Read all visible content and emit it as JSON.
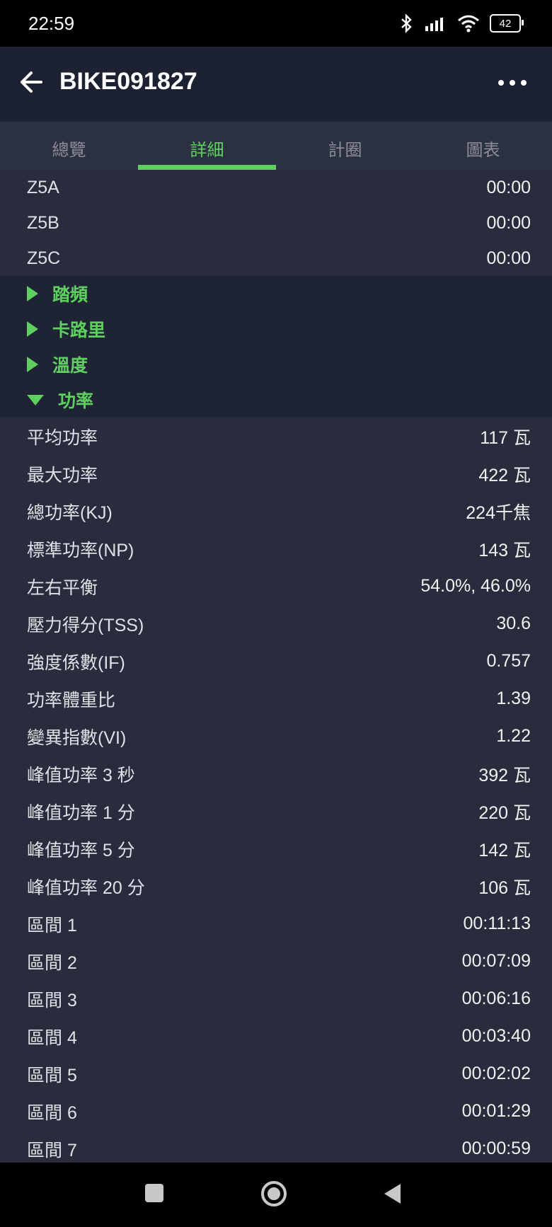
{
  "status": {
    "time": "22:59",
    "battery": "42",
    "signal_sub": "6"
  },
  "appbar": {
    "title": "BIKE091827"
  },
  "tabs": [
    {
      "label": "總覽",
      "active": false
    },
    {
      "label": "詳細",
      "active": true
    },
    {
      "label": "計圈",
      "active": false
    },
    {
      "label": "圖表",
      "active": false
    }
  ],
  "zones": [
    {
      "label": "Z5A",
      "value": "00:00"
    },
    {
      "label": "Z5B",
      "value": "00:00"
    },
    {
      "label": "Z5C",
      "value": "00:00"
    }
  ],
  "sections": [
    {
      "label": "踏頻",
      "expanded": false
    },
    {
      "label": "卡路里",
      "expanded": false
    },
    {
      "label": "溫度",
      "expanded": false
    },
    {
      "label": "功率",
      "expanded": true
    }
  ],
  "power": [
    {
      "label": "平均功率",
      "value": "117 瓦"
    },
    {
      "label": "最大功率",
      "value": "422 瓦"
    },
    {
      "label": "總功率(KJ)",
      "value": "224千焦"
    },
    {
      "label": "標準功率(NP)",
      "value": "143 瓦"
    },
    {
      "label": "左右平衡",
      "value": "54.0%, 46.0%"
    },
    {
      "label": "壓力得分(TSS)",
      "value": "30.6"
    },
    {
      "label": "強度係數(IF)",
      "value": "0.757"
    },
    {
      "label": "功率體重比",
      "value": "1.39"
    },
    {
      "label": "變異指數(VI)",
      "value": "1.22"
    },
    {
      "label": "峰值功率 3 秒",
      "value": "392 瓦"
    },
    {
      "label": "峰值功率 1 分",
      "value": "220 瓦"
    },
    {
      "label": "峰值功率 5 分",
      "value": "142 瓦"
    },
    {
      "label": "峰值功率 20 分",
      "value": "106 瓦"
    },
    {
      "label": "區間 1",
      "value": "00:11:13"
    },
    {
      "label": "區間 2",
      "value": "00:07:09"
    },
    {
      "label": "區間 3",
      "value": "00:06:16"
    },
    {
      "label": "區間 4",
      "value": "00:03:40"
    },
    {
      "label": "區間 5",
      "value": "00:02:02"
    },
    {
      "label": "區間 6",
      "value": "00:01:29"
    },
    {
      "label": "區間 7",
      "value": "00:00:59"
    }
  ],
  "colors": {
    "accent": "#5ed060",
    "background": "#282c3c",
    "section_bg": "#1f2434",
    "appbar_bg": "#1d2232"
  },
  "icons": {
    "back": "arrow-left-icon",
    "more": "more-horizontal-icon",
    "bluetooth": "bluetooth-icon",
    "signal": "signal-icon",
    "wifi": "wifi-icon",
    "battery": "battery-icon",
    "nav_recents": "square-icon",
    "nav_home": "circle-icon",
    "nav_back": "triangle-back-icon"
  }
}
